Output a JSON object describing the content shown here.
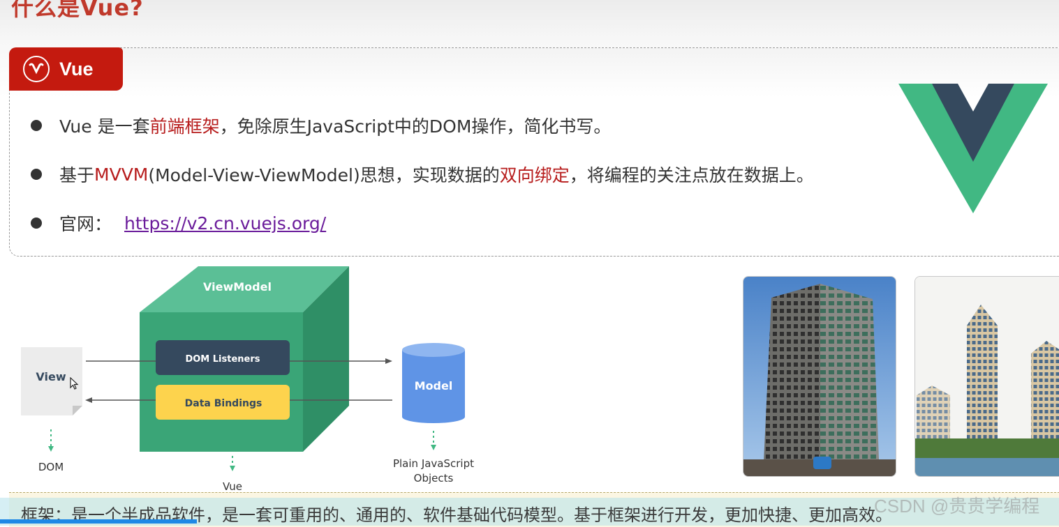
{
  "page": {
    "title": "什么是Vue?"
  },
  "badge": {
    "label": "Vue",
    "icon": "vue-v-icon",
    "color": "#c41a0f"
  },
  "bullets": [
    {
      "parts": [
        "Vue 是一套",
        "前端框架",
        "，免除原生JavaScript中的DOM操作，简化书写。"
      ]
    },
    {
      "parts": [
        "基于",
        "MVVM",
        "(Model-View-ViewModel)思想，实现数据的",
        "双向绑定",
        "，将编程的关注点放在数据上。"
      ]
    },
    {
      "label": "官网：",
      "link": "https://v2.cn.vuejs.org/"
    }
  ],
  "diagram": {
    "viewmodel_label": "ViewModel",
    "view_label": "View",
    "dom_listeners_label": "DOM Listeners",
    "data_bindings_label": "Data Bindings",
    "model_label": "Model",
    "dom_caption": "DOM",
    "vue_caption": "Vue",
    "model_caption_line1": "Plain JavaScript",
    "model_caption_line2": "Objects"
  },
  "caption": {
    "text": "框架：是一个半成品软件，是一套可重用的、通用的、软件基础代码模型。基于框架进行开发，更加快捷、更加高效。"
  },
  "watermark": {
    "text": "CSDN @贵贵学编程"
  },
  "colors": {
    "accent_red": "#c41a0f",
    "vue_green": "#41b883",
    "vue_dark": "#35495e",
    "link_purple": "#6a1b9a"
  }
}
